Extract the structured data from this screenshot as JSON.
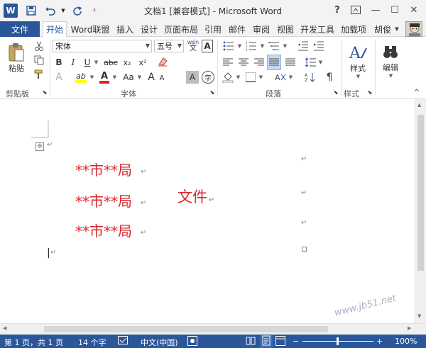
{
  "window": {
    "title": "文档1 [兼容模式] - Microsoft Word",
    "help_label": "?",
    "minimize_label": "—",
    "maximize_label": "☐",
    "close_label": "✕"
  },
  "tabs": {
    "file": "文件",
    "items": [
      "开始",
      "Word联盟",
      "插入",
      "设计",
      "页面布局",
      "引用",
      "邮件",
      "审阅",
      "视图",
      "开发工具",
      "加载项"
    ],
    "user": "胡俊"
  },
  "ribbon": {
    "clipboard": {
      "paste_label": "粘贴",
      "group_label": "剪贴板"
    },
    "font": {
      "font_name": "宋体",
      "font_size": "五号",
      "phonetic_label": "wén",
      "char_border_label": "A",
      "bold": "B",
      "italic": "I",
      "underline": "U",
      "strike": "abc",
      "subscript": "x₂",
      "superscript": "x²",
      "text_effects": "A",
      "highlight": "ab",
      "font_color": "A",
      "change_case": "Aa",
      "grow": "A",
      "shrink": "A",
      "char_shading": "A",
      "enclose": "字",
      "group_label": "字体"
    },
    "paragraph": {
      "group_label": "段落"
    },
    "styles": {
      "label": "样式",
      "group_label": "样式"
    },
    "editing": {
      "label": "编辑"
    }
  },
  "document": {
    "line1": "**市**局",
    "line2": "**市**局",
    "line2_suffix": "文件",
    "line3": "**市**局",
    "para_mark": "↵",
    "cursor": "|"
  },
  "status": {
    "page": "第 1 页，共 1 页",
    "words": "14 个字",
    "language": "中文(中国)",
    "zoom": "100%",
    "watermark": "www.jb51.net"
  },
  "colors": {
    "accent": "#2b579a",
    "doc_red": "#d9262e"
  }
}
